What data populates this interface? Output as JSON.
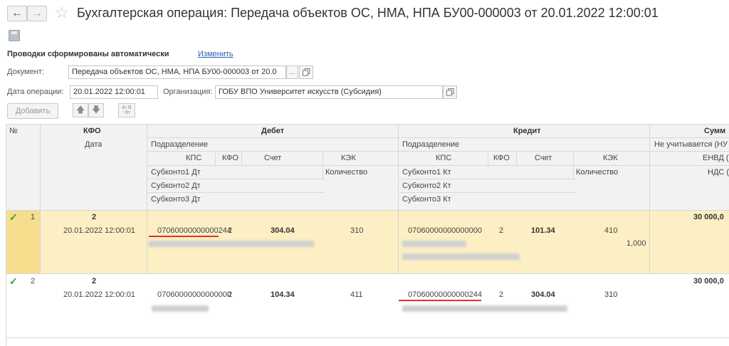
{
  "window": {
    "title": "Бухгалтерская операция: Передача объектов ОС, НМА, НПА БУ00-000003 от 20.01.2022 12:00:01",
    "back_glyph": "←",
    "forward_glyph": "→",
    "favorite_glyph": "☆"
  },
  "header_info": {
    "auto_note": "Проводки сформированы автоматически",
    "change_link": "Изменить"
  },
  "form": {
    "document_label": "Документ:",
    "document_value": "Передача объектов ОС, НМА, НПА БУ00-000003 от 20.0",
    "document_select": "...",
    "date_label": "Дата операции:",
    "date_value": "20.01.2022 12:00:01",
    "org_label": "Организация:",
    "org_value": "ГОБУ ВПО Университет искусств (Субсидия)"
  },
  "toolbar": {
    "add_label": "Добавить",
    "up_glyph": "🡅",
    "down_glyph": "🡇",
    "sort_label_top": "А↑Я",
    "sort_label_bottom": "↑Кт"
  },
  "table": {
    "headers": {
      "num": "№",
      "kfo": "КФО",
      "date": "Дата",
      "debit": "Дебет",
      "credit": "Кредит",
      "sum": "Сумм",
      "dept": "Подразделение",
      "kps": "КПС",
      "kfo_small": "КФО",
      "account": "Счет",
      "kek": "КЭК",
      "sub1_dt": "Субконто1 Дт",
      "sub2_dt": "Субконто2 Дт",
      "sub3_dt": "Субконто3 Дт",
      "sub1_kt": "Субконто1 Кт",
      "sub2_kt": "Субконто2 Кт",
      "sub3_kt": "Субконто3 Кт",
      "qty": "Количество",
      "not_counted": "Не учитывается (НУ",
      "envd": "ЕНВД (НУ",
      "vat": "НДС (НУ"
    },
    "rows": [
      {
        "num": "1",
        "kfo": "2",
        "date": "20.01.2022 12:00:01",
        "dt_kps": "07060000000000244",
        "dt_kfo": "2",
        "dt_account": "304.04",
        "dt_kek": "310",
        "kt_kps": "07060000000000000",
        "kt_kfo": "2",
        "kt_account": "101.34",
        "kt_kek": "410",
        "qty": "1,000",
        "sum": "30 000,0"
      },
      {
        "num": "2",
        "kfo": "2",
        "date": "20.01.2022 12:00:01",
        "dt_kps": "07060000000000000",
        "dt_kfo": "2",
        "dt_account": "104.34",
        "dt_kek": "411",
        "kt_kps": "07060000000000244",
        "kt_kfo": "2",
        "kt_account": "304.04",
        "kt_kek": "310",
        "sum": "30 000,0"
      }
    ]
  },
  "icons": [
    "arrow-left-icon",
    "arrow-right-icon",
    "star-icon",
    "save-icon",
    "copy-icon",
    "arrow-up-icon",
    "arrow-down-icon",
    "sort-icon",
    "check-icon"
  ]
}
